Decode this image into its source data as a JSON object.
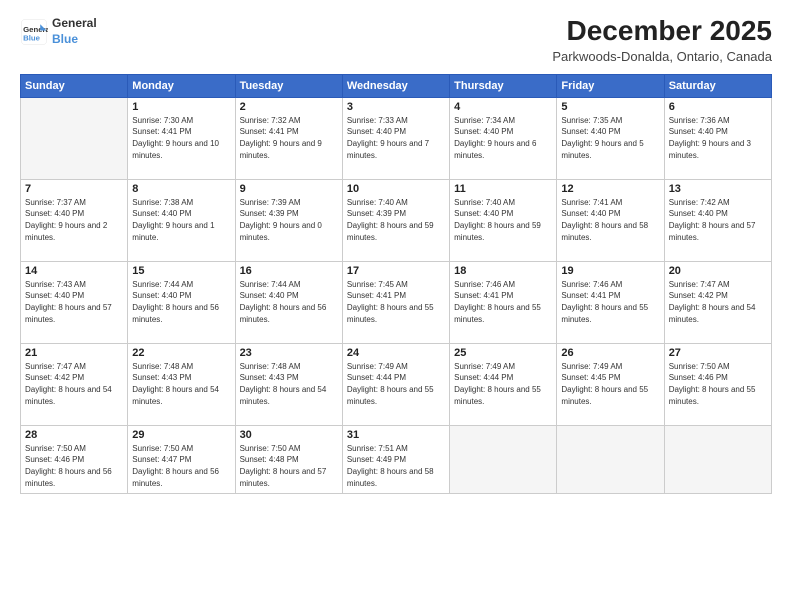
{
  "logo": {
    "line1": "General",
    "line2": "Blue"
  },
  "title": "December 2025",
  "location": "Parkwoods-Donalda, Ontario, Canada",
  "weekdays": [
    "Sunday",
    "Monday",
    "Tuesday",
    "Wednesday",
    "Thursday",
    "Friday",
    "Saturday"
  ],
  "weeks": [
    [
      {
        "day": "",
        "empty": true
      },
      {
        "day": "1",
        "sunrise": "7:30 AM",
        "sunset": "4:41 PM",
        "daylight": "9 hours and 10 minutes."
      },
      {
        "day": "2",
        "sunrise": "7:32 AM",
        "sunset": "4:41 PM",
        "daylight": "9 hours and 9 minutes."
      },
      {
        "day": "3",
        "sunrise": "7:33 AM",
        "sunset": "4:40 PM",
        "daylight": "9 hours and 7 minutes."
      },
      {
        "day": "4",
        "sunrise": "7:34 AM",
        "sunset": "4:40 PM",
        "daylight": "9 hours and 6 minutes."
      },
      {
        "day": "5",
        "sunrise": "7:35 AM",
        "sunset": "4:40 PM",
        "daylight": "9 hours and 5 minutes."
      },
      {
        "day": "6",
        "sunrise": "7:36 AM",
        "sunset": "4:40 PM",
        "daylight": "9 hours and 3 minutes."
      }
    ],
    [
      {
        "day": "7",
        "sunrise": "7:37 AM",
        "sunset": "4:40 PM",
        "daylight": "9 hours and 2 minutes."
      },
      {
        "day": "8",
        "sunrise": "7:38 AM",
        "sunset": "4:40 PM",
        "daylight": "9 hours and 1 minute."
      },
      {
        "day": "9",
        "sunrise": "7:39 AM",
        "sunset": "4:39 PM",
        "daylight": "9 hours and 0 minutes."
      },
      {
        "day": "10",
        "sunrise": "7:40 AM",
        "sunset": "4:39 PM",
        "daylight": "8 hours and 59 minutes."
      },
      {
        "day": "11",
        "sunrise": "7:40 AM",
        "sunset": "4:40 PM",
        "daylight": "8 hours and 59 minutes."
      },
      {
        "day": "12",
        "sunrise": "7:41 AM",
        "sunset": "4:40 PM",
        "daylight": "8 hours and 58 minutes."
      },
      {
        "day": "13",
        "sunrise": "7:42 AM",
        "sunset": "4:40 PM",
        "daylight": "8 hours and 57 minutes."
      }
    ],
    [
      {
        "day": "14",
        "sunrise": "7:43 AM",
        "sunset": "4:40 PM",
        "daylight": "8 hours and 57 minutes."
      },
      {
        "day": "15",
        "sunrise": "7:44 AM",
        "sunset": "4:40 PM",
        "daylight": "8 hours and 56 minutes."
      },
      {
        "day": "16",
        "sunrise": "7:44 AM",
        "sunset": "4:40 PM",
        "daylight": "8 hours and 56 minutes."
      },
      {
        "day": "17",
        "sunrise": "7:45 AM",
        "sunset": "4:41 PM",
        "daylight": "8 hours and 55 minutes."
      },
      {
        "day": "18",
        "sunrise": "7:46 AM",
        "sunset": "4:41 PM",
        "daylight": "8 hours and 55 minutes."
      },
      {
        "day": "19",
        "sunrise": "7:46 AM",
        "sunset": "4:41 PM",
        "daylight": "8 hours and 55 minutes."
      },
      {
        "day": "20",
        "sunrise": "7:47 AM",
        "sunset": "4:42 PM",
        "daylight": "8 hours and 54 minutes."
      }
    ],
    [
      {
        "day": "21",
        "sunrise": "7:47 AM",
        "sunset": "4:42 PM",
        "daylight": "8 hours and 54 minutes."
      },
      {
        "day": "22",
        "sunrise": "7:48 AM",
        "sunset": "4:43 PM",
        "daylight": "8 hours and 54 minutes."
      },
      {
        "day": "23",
        "sunrise": "7:48 AM",
        "sunset": "4:43 PM",
        "daylight": "8 hours and 54 minutes."
      },
      {
        "day": "24",
        "sunrise": "7:49 AM",
        "sunset": "4:44 PM",
        "daylight": "8 hours and 55 minutes."
      },
      {
        "day": "25",
        "sunrise": "7:49 AM",
        "sunset": "4:44 PM",
        "daylight": "8 hours and 55 minutes."
      },
      {
        "day": "26",
        "sunrise": "7:49 AM",
        "sunset": "4:45 PM",
        "daylight": "8 hours and 55 minutes."
      },
      {
        "day": "27",
        "sunrise": "7:50 AM",
        "sunset": "4:46 PM",
        "daylight": "8 hours and 55 minutes."
      }
    ],
    [
      {
        "day": "28",
        "sunrise": "7:50 AM",
        "sunset": "4:46 PM",
        "daylight": "8 hours and 56 minutes."
      },
      {
        "day": "29",
        "sunrise": "7:50 AM",
        "sunset": "4:47 PM",
        "daylight": "8 hours and 56 minutes."
      },
      {
        "day": "30",
        "sunrise": "7:50 AM",
        "sunset": "4:48 PM",
        "daylight": "8 hours and 57 minutes."
      },
      {
        "day": "31",
        "sunrise": "7:51 AM",
        "sunset": "4:49 PM",
        "daylight": "8 hours and 58 minutes."
      },
      {
        "day": "",
        "empty": true
      },
      {
        "day": "",
        "empty": true
      },
      {
        "day": "",
        "empty": true
      }
    ]
  ]
}
